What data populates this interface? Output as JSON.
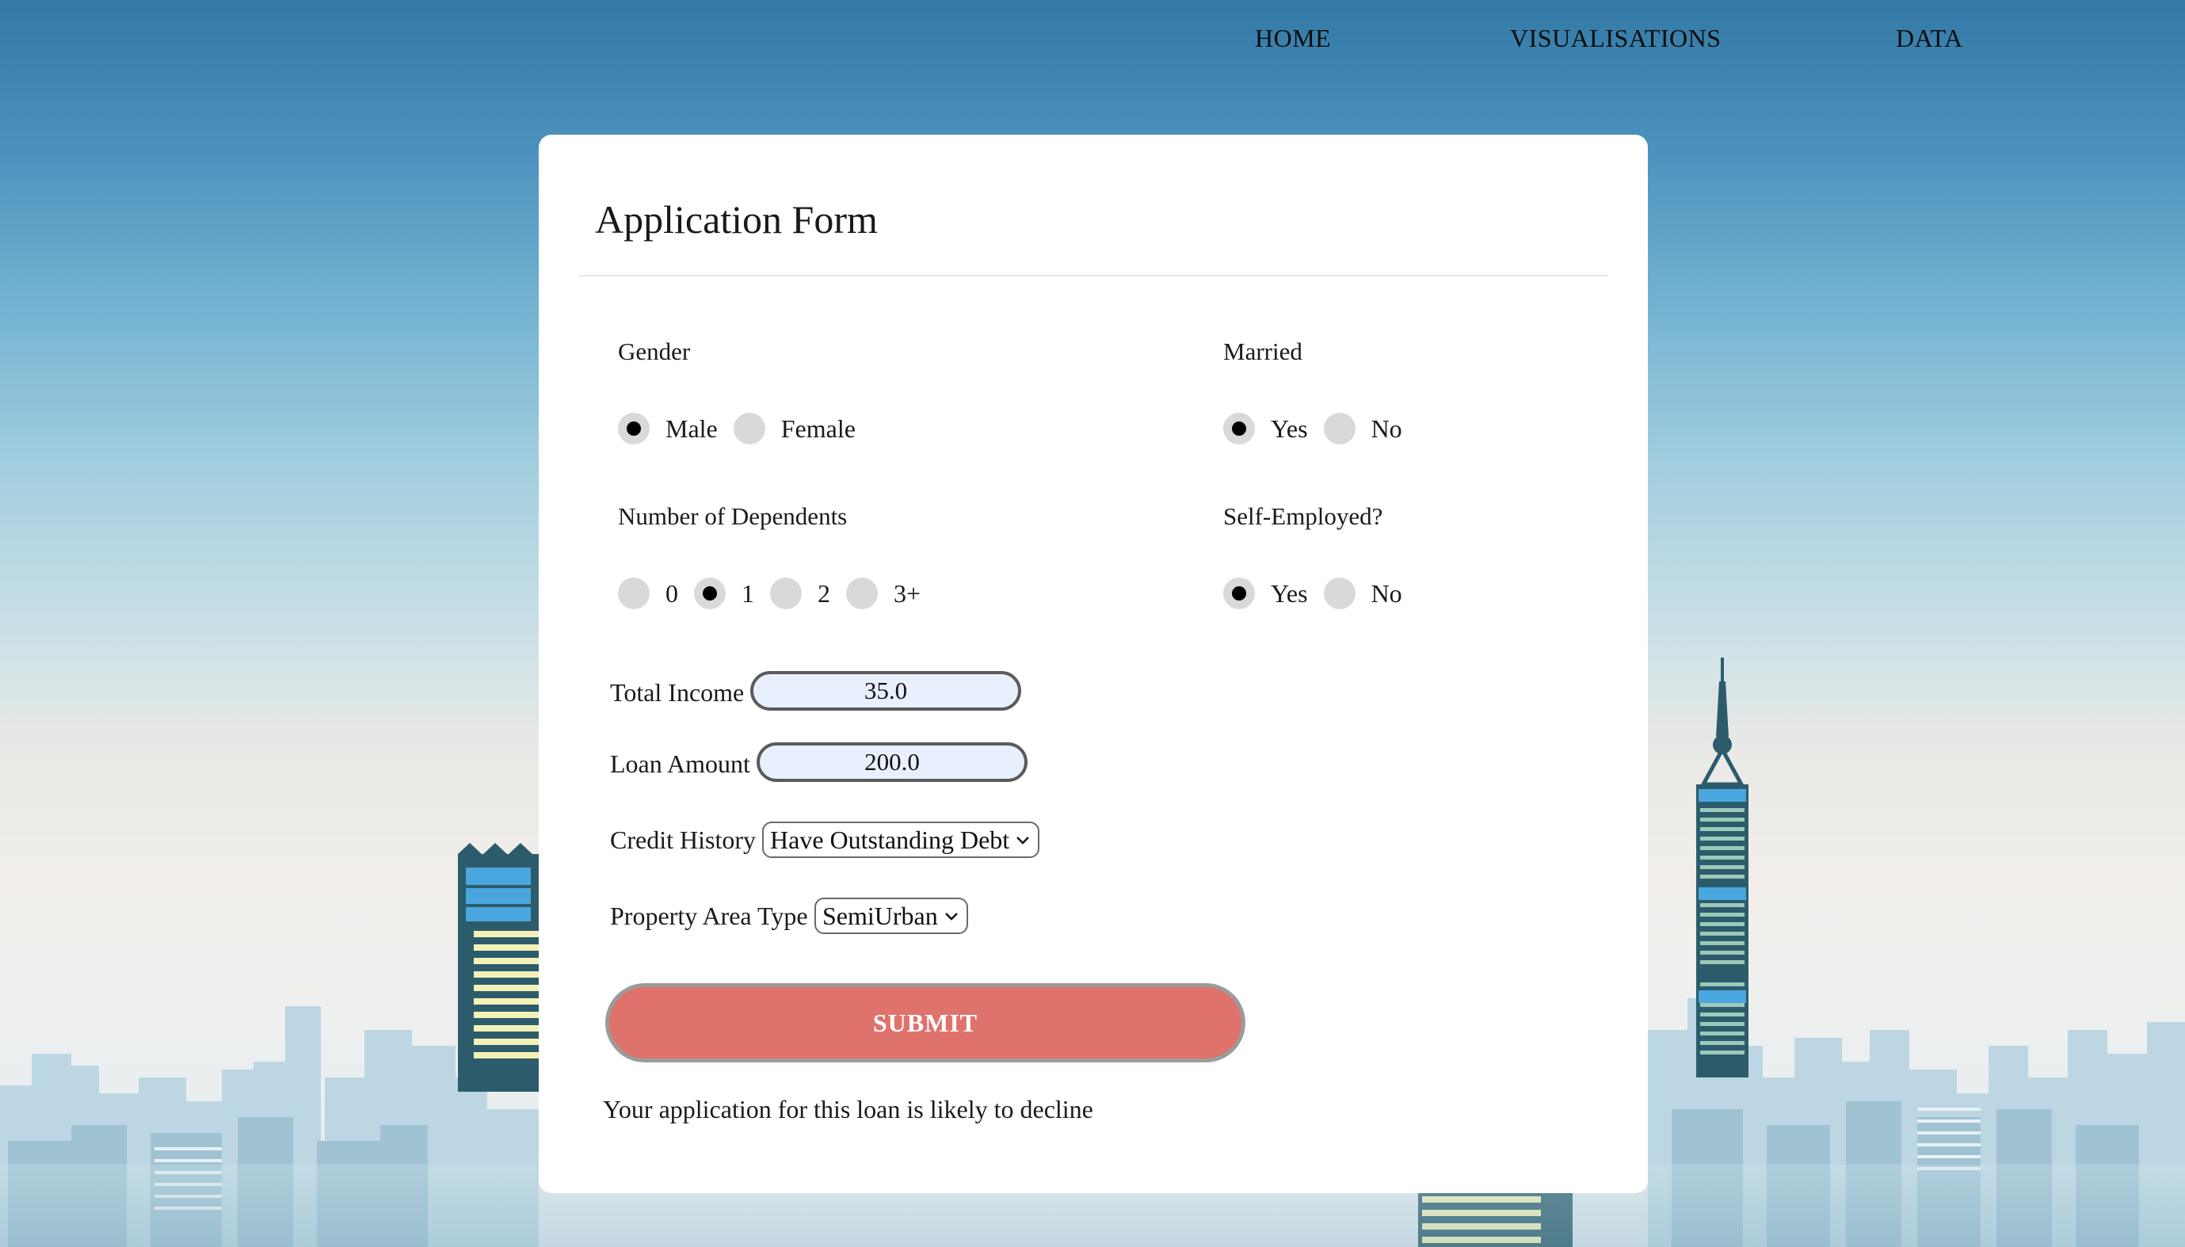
{
  "nav": {
    "home": "HOME",
    "visualisations": "VISUALISATIONS",
    "data": "DATA"
  },
  "form": {
    "title": "Application Form",
    "gender": {
      "label": "Gender",
      "options": [
        "Male",
        "Female"
      ],
      "selected": "Male"
    },
    "married": {
      "label": "Married",
      "options": [
        "Yes",
        "No"
      ],
      "selected": "Yes"
    },
    "dependents": {
      "label": "Number of Dependents",
      "options": [
        "0",
        "1",
        "2",
        "3+"
      ],
      "selected": "1"
    },
    "self_employed": {
      "label": "Self-Employed?",
      "options": [
        "Yes",
        "No"
      ],
      "selected": "Yes"
    },
    "total_income": {
      "label": "Total Income",
      "value": "35.0"
    },
    "loan_amount": {
      "label": "Loan Amount",
      "value": "200.0"
    },
    "credit_history": {
      "label": "Credit History",
      "value": "Have Outstanding Debt"
    },
    "property_area": {
      "label": "Property Area Type",
      "value": "SemiUrban"
    },
    "submit_label": "SUBMIT",
    "result": "Your application for this loan is likely to decline"
  },
  "colors": {
    "submit": "#e0726c",
    "input_bg": "#e8f0fe",
    "sky_top": "#3479a6"
  }
}
